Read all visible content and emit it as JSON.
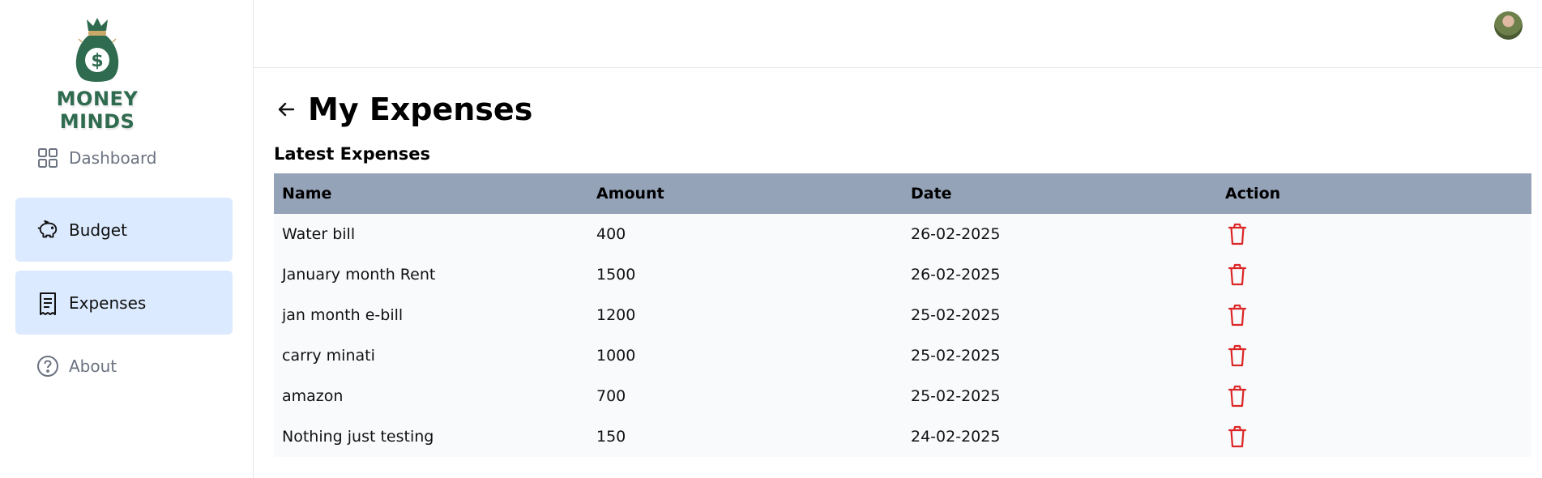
{
  "brand": {
    "name": "MONEY MINDS",
    "color": "#2f6b4f"
  },
  "sidebar": {
    "items": [
      {
        "label": "Dashboard",
        "icon": "grid-icon",
        "active": false
      },
      {
        "label": "Budget",
        "icon": "piggy-bank-icon",
        "active": true
      },
      {
        "label": "Expenses",
        "icon": "receipt-icon",
        "active": true
      },
      {
        "label": "About",
        "icon": "help-circle-icon",
        "active": false
      }
    ]
  },
  "header": {
    "avatar_icon": "user-avatar"
  },
  "page": {
    "title": "My Expenses",
    "section_title": "Latest Expenses"
  },
  "table": {
    "headers": [
      "Name",
      "Amount",
      "Date",
      "Action"
    ],
    "rows": [
      {
        "name": "Water bill",
        "amount": "400",
        "date": "26-02-2025"
      },
      {
        "name": "January month Rent",
        "amount": "1500",
        "date": "26-02-2025"
      },
      {
        "name": "jan month e-bill",
        "amount": "1200",
        "date": "25-02-2025"
      },
      {
        "name": "carry minati",
        "amount": "1000",
        "date": "25-02-2025"
      },
      {
        "name": "amazon",
        "amount": "700",
        "date": "25-02-2025"
      },
      {
        "name": "Nothing just testing",
        "amount": "150",
        "date": "24-02-2025"
      }
    ],
    "action_icon": "trash-icon",
    "action_color": "#dc2626",
    "header_bg": "#94a3b8",
    "row_bg": "#f8fafc"
  }
}
